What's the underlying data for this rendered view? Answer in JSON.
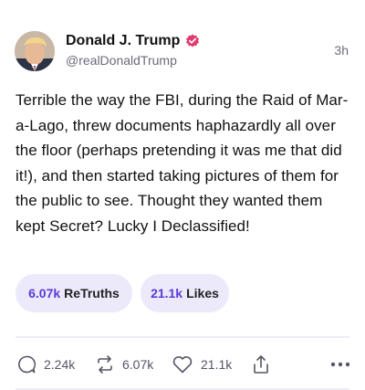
{
  "post": {
    "author": {
      "display_name": "Donald J. Trump",
      "handle": "@realDonaldTrump",
      "verified": true,
      "avatar_icon": "profile-photo"
    },
    "timestamp": "3h",
    "text": "Terrible the way the FBI, during the Raid of Mar-a-Lago, threw documents haphazardly all over the floor (perhaps pretending it was me that did it!), and then started taking pictures of them for the public to see. Thought they wanted them kept Secret? Lucky I Declassified!",
    "engagement": {
      "retruths_count": "6.07k",
      "retruths_label": "ReTruths",
      "likes_count": "21.1k",
      "likes_label": "Likes"
    },
    "actions": {
      "reply_count": "2.24k",
      "retruth_count": "6.07k",
      "like_count": "21.1k",
      "icons": [
        "reply-icon",
        "retruth-icon",
        "heart-icon",
        "share-icon",
        "more-icon"
      ]
    }
  },
  "colors": {
    "accent": "#5b3bd6",
    "pill_bg": "#ece9fb",
    "verified": "#e03c6e",
    "muted": "#6b6b7b"
  }
}
